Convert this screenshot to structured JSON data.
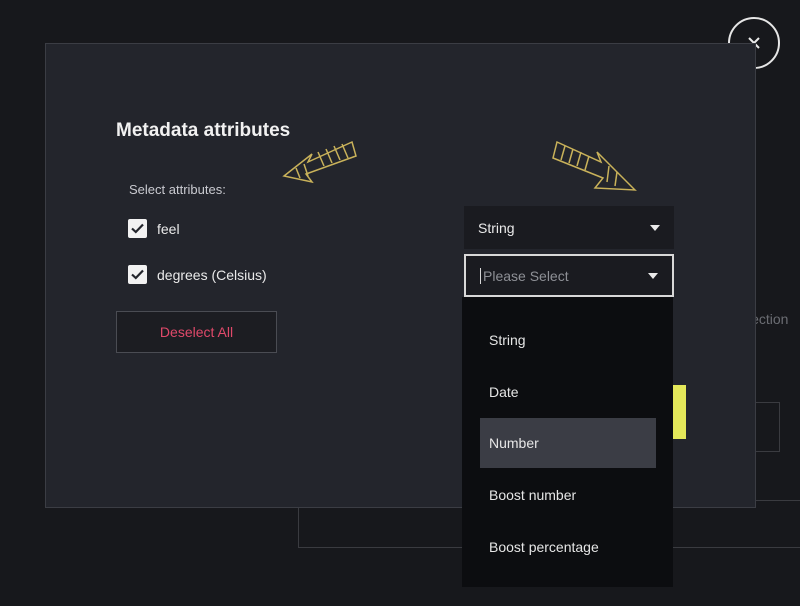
{
  "background": {
    "partial_text": "lection"
  },
  "dialog": {
    "title": "Metadata attributes",
    "select_label": "Select attributes:",
    "attributes": [
      {
        "label": "feel",
        "checked": true,
        "type": "String"
      },
      {
        "label": "degrees (Celsius)",
        "checked": true,
        "type": ""
      }
    ],
    "type_placeholder": "Please Select",
    "deselect_all": "Deselect All"
  },
  "dropdown": {
    "options": [
      "String",
      "Date",
      "Number",
      "Boost number",
      "Boost percentage"
    ],
    "highlighted": "Number"
  },
  "colors": {
    "accent_pink": "#e0496a",
    "scroll_thumb": "#e4e85a",
    "annotation_arrow": "#c9b25a"
  },
  "icons": {
    "close": "close-icon",
    "checkbox": "checkmark-icon",
    "caret": "caret-down-icon",
    "annotation": "arrow-annotation-icon"
  }
}
